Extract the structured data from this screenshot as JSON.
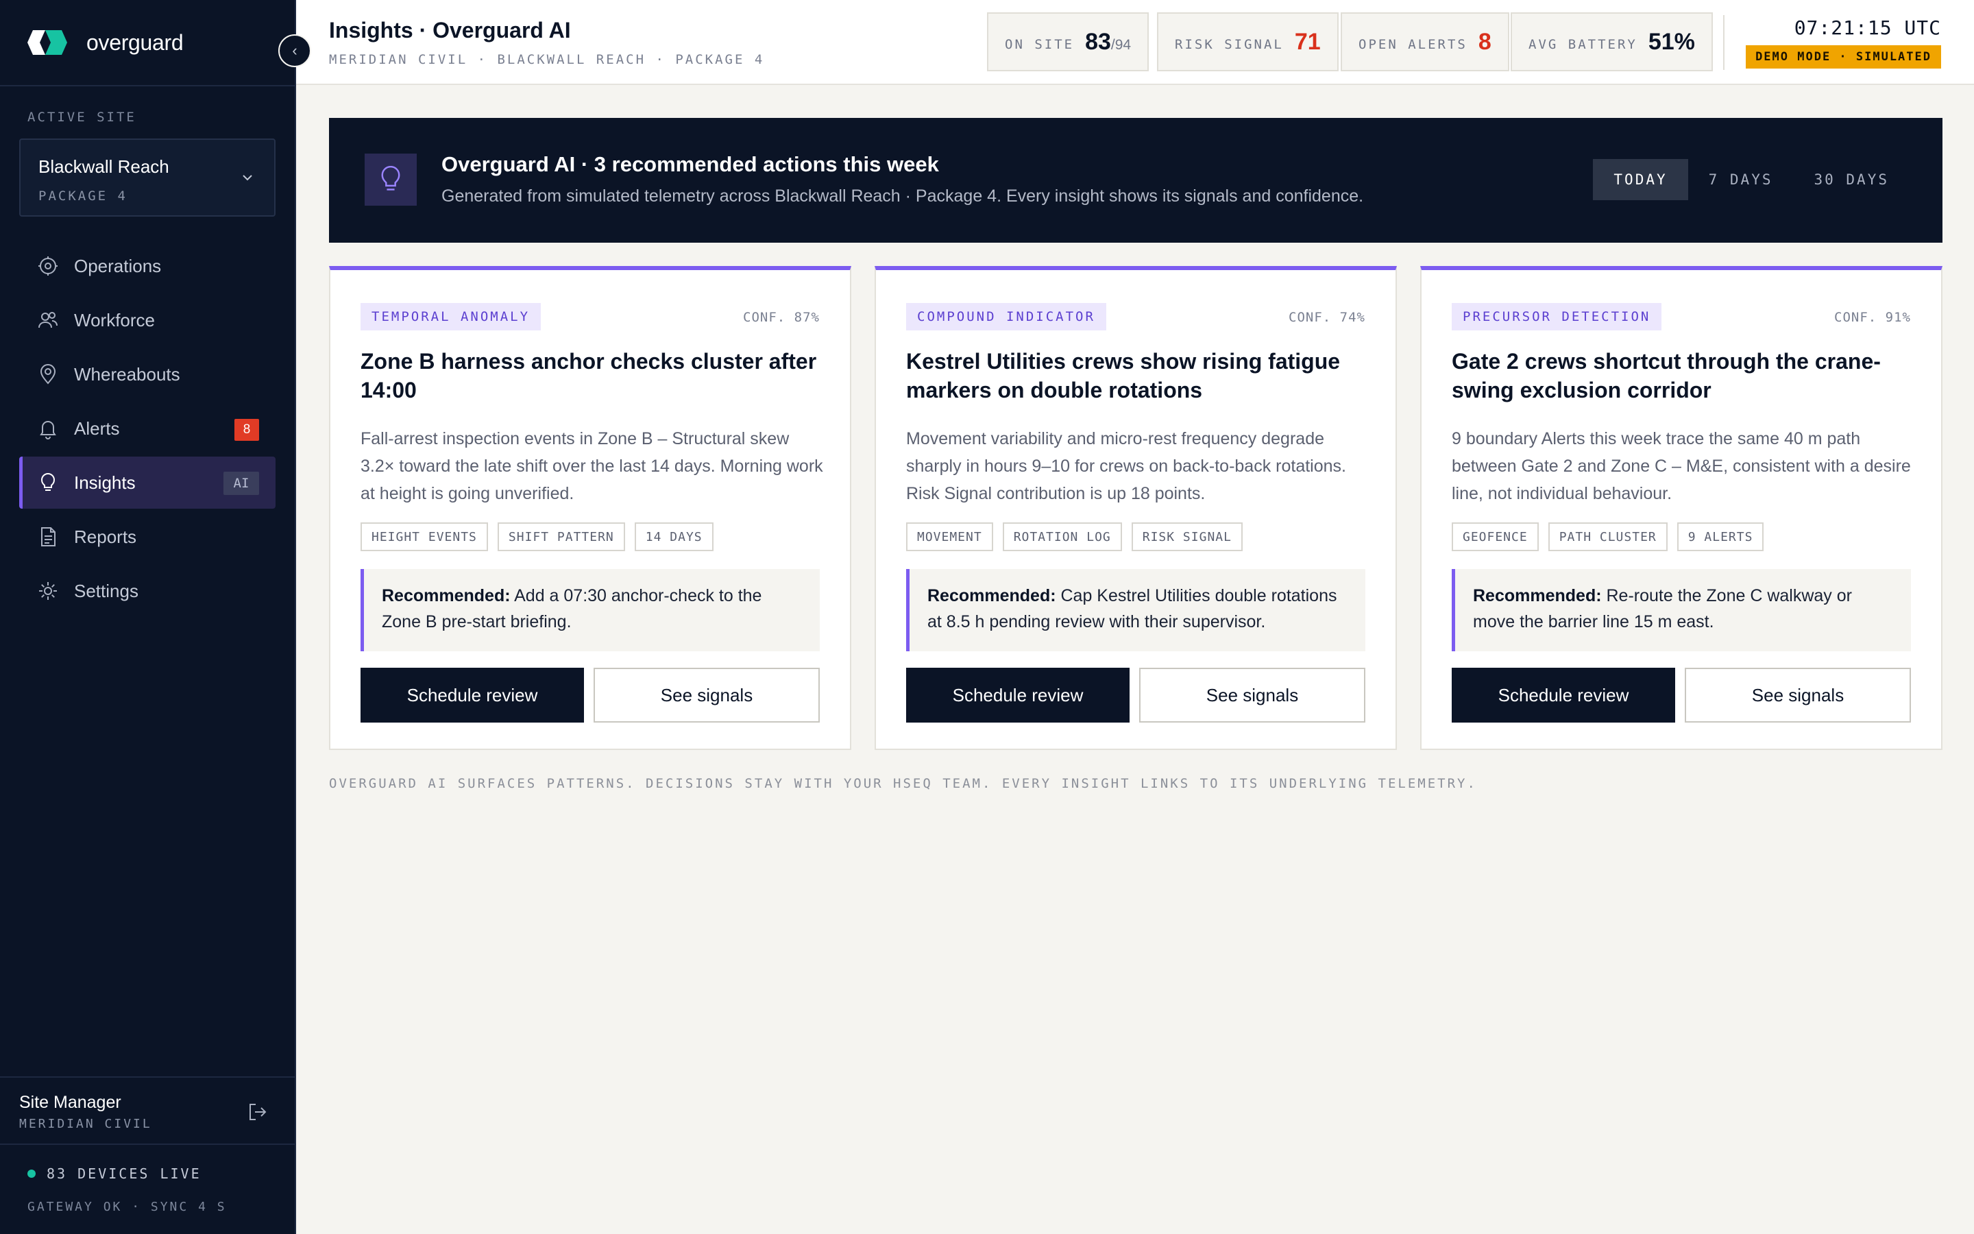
{
  "brand": {
    "name": "overguard"
  },
  "sidebar": {
    "active_site_label": "ACTIVE SITE",
    "site": {
      "name": "Blackwall Reach",
      "package": "PACKAGE 4"
    },
    "nav": [
      {
        "label": "Operations",
        "icon": "operations-icon"
      },
      {
        "label": "Workforce",
        "icon": "users-icon"
      },
      {
        "label": "Whereabouts",
        "icon": "location-pin-icon"
      },
      {
        "label": "Alerts",
        "icon": "bell-icon",
        "badge": "8"
      },
      {
        "label": "Insights",
        "icon": "lightbulb-icon",
        "tag": "AI",
        "active": true
      },
      {
        "label": "Reports",
        "icon": "document-icon"
      },
      {
        "label": "Settings",
        "icon": "gear-icon"
      }
    ],
    "user": {
      "name": "Site Manager",
      "org": "MERIDIAN CIVIL"
    },
    "status": {
      "devices": "83 DEVICES LIVE",
      "gateway": "GATEWAY OK · SYNC 4 S"
    }
  },
  "header": {
    "title": "Insights · Overguard AI",
    "breadcrumb": "MERIDIAN CIVIL · BLACKWALL REACH · PACKAGE 4",
    "stats": {
      "on_site": {
        "label": "ON SITE",
        "value": "83",
        "total": "/94"
      },
      "risk_signal": {
        "label": "RISK SIGNAL",
        "value": "71"
      },
      "open_alerts": {
        "label": "OPEN ALERTS",
        "value": "8"
      },
      "avg_battery": {
        "label": "AVG BATTERY",
        "value": "51%"
      }
    },
    "clock": "07:21:15 UTC",
    "demo_badge": "DEMO MODE · SIMULATED"
  },
  "banner": {
    "title": "Overguard AI · 3 recommended actions this week",
    "subtitle": "Generated from simulated telemetry across Blackwall Reach · Package 4. Every insight shows its signals and confidence.",
    "ranges": [
      "TODAY",
      "7 DAYS",
      "30 DAYS"
    ],
    "active_range": "TODAY"
  },
  "insights": [
    {
      "tag": "TEMPORAL ANOMALY",
      "confidence": "CONF. 87%",
      "title": "Zone B harness anchor checks cluster after 14:00",
      "body": "Fall-arrest inspection events in Zone B – Structural skew 3.2× toward the late shift over the last 14 days. Morning work at height is going unverified.",
      "chips": [
        "HEIGHT EVENTS",
        "SHIFT PATTERN",
        "14 DAYS"
      ],
      "reco_label": "Recommended:",
      "reco_text": " Add a 07:30 anchor-check to the Zone B pre-start briefing.",
      "primary": "Schedule review",
      "secondary": "See signals"
    },
    {
      "tag": "COMPOUND INDICATOR",
      "confidence": "CONF. 74%",
      "title": "Kestrel Utilities crews show rising fatigue markers on double rotations",
      "body": "Movement variability and micro-rest frequency degrade sharply in hours 9–10 for crews on back-to-back rotations. Risk Signal contribution is up 18 points.",
      "chips": [
        "MOVEMENT",
        "ROTATION LOG",
        "RISK SIGNAL"
      ],
      "reco_label": "Recommended:",
      "reco_text": " Cap Kestrel Utilities double rotations at 8.5 h pending review with their supervisor.",
      "primary": "Schedule review",
      "secondary": "See signals"
    },
    {
      "tag": "PRECURSOR DETECTION",
      "confidence": "CONF. 91%",
      "title": "Gate 2 crews shortcut through the crane-swing exclusion corridor",
      "body": "9 boundary Alerts this week trace the same 40 m path between Gate 2 and Zone C – M&E, consistent with a desire line, not individual behaviour.",
      "chips": [
        "GEOFENCE",
        "PATH CLUSTER",
        "9 ALERTS"
      ],
      "reco_label": "Recommended:",
      "reco_text": " Re-route the Zone C walkway or move the barrier line 15 m east.",
      "primary": "Schedule review",
      "secondary": "See signals"
    }
  ],
  "footnote": "OVERGUARD AI SURFACES PATTERNS. DECISIONS STAY WITH YOUR HSEQ TEAM. EVERY INSIGHT LINKS TO ITS UNDERLYING TELEMETRY.",
  "colors": {
    "navy": "#0b1426",
    "accent": "#7c5cf0",
    "alert_red": "#d9311c",
    "demo_amber": "#f0a400",
    "live_green": "#17c3a2"
  }
}
